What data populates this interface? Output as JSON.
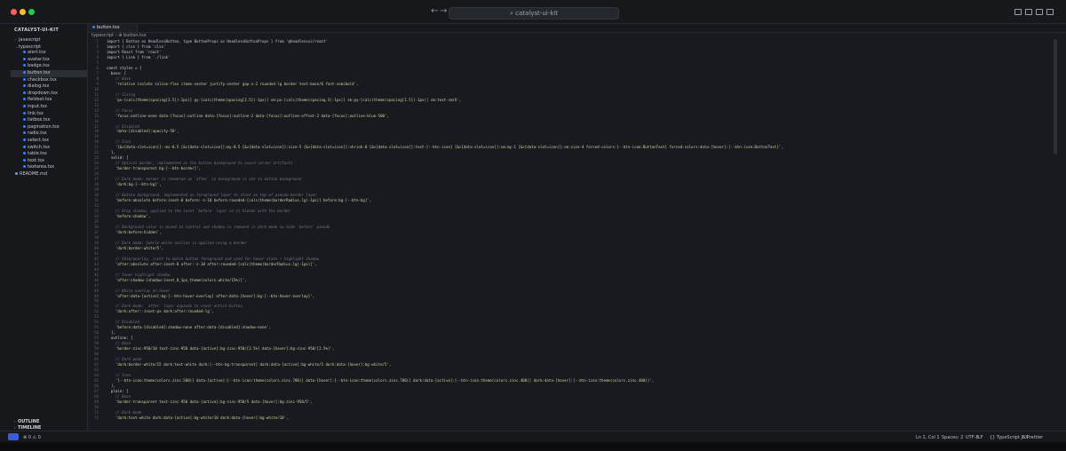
{
  "window": {
    "search_text": "⌕ catalyst-ui-kit",
    "nav_back": "←",
    "nav_forward": "→"
  },
  "sidebar": {
    "title": "CATALYST-UI-KIT",
    "tree": [
      {
        "label": "javascript",
        "type": "folder",
        "depth": 1,
        "chevron": "›"
      },
      {
        "label": "typescript",
        "type": "folder",
        "depth": 1,
        "chevron": "⌄"
      },
      {
        "label": "alert.tsx",
        "type": "file",
        "depth": 2
      },
      {
        "label": "avatar.tsx",
        "type": "file",
        "depth": 2
      },
      {
        "label": "badge.tsx",
        "type": "file",
        "depth": 2
      },
      {
        "label": "button.tsx",
        "type": "file",
        "depth": 2,
        "active": true
      },
      {
        "label": "checkbox.tsx",
        "type": "file",
        "depth": 2
      },
      {
        "label": "dialog.tsx",
        "type": "file",
        "depth": 2
      },
      {
        "label": "dropdown.tsx",
        "type": "file",
        "depth": 2
      },
      {
        "label": "fieldset.tsx",
        "type": "file",
        "depth": 2
      },
      {
        "label": "input.tsx",
        "type": "file",
        "depth": 2
      },
      {
        "label": "link.tsx",
        "type": "file",
        "depth": 2
      },
      {
        "label": "listbox.tsx",
        "type": "file",
        "depth": 2
      },
      {
        "label": "pagination.tsx",
        "type": "file",
        "depth": 2
      },
      {
        "label": "radio.tsx",
        "type": "file",
        "depth": 2
      },
      {
        "label": "select.tsx",
        "type": "file",
        "depth": 2
      },
      {
        "label": "switch.tsx",
        "type": "file",
        "depth": 2
      },
      {
        "label": "table.tsx",
        "type": "file",
        "depth": 2
      },
      {
        "label": "text.tsx",
        "type": "file",
        "depth": 2
      },
      {
        "label": "textarea.tsx",
        "type": "file",
        "depth": 2
      },
      {
        "label": "README.md",
        "type": "md",
        "depth": 1
      }
    ],
    "outline_label": "OUTLINE",
    "timeline_label": "TIMELINE"
  },
  "editor": {
    "tab_label": "button.tsx",
    "breadcrumb": "typescript › ⊕ button.tsx",
    "lines": [
      {
        "n": "1",
        "t": "import { Button as HeadlessButton, type ButtonProps as HeadlessButtonProps } from '@headlessui/react'",
        "k": "kw"
      },
      {
        "n": "2",
        "t": "import { clsx } from 'clsx'",
        "k": "kw"
      },
      {
        "n": "3",
        "t": "import React from 'react'",
        "k": "kw"
      },
      {
        "n": "4",
        "t": "import { Link } from './link'",
        "k": "kw"
      },
      {
        "n": "5",
        "t": "",
        "k": ""
      },
      {
        "n": "6",
        "t": "const styles = {",
        "k": ""
      },
      {
        "n": "7",
        "t": "  base: [",
        "k": ""
      },
      {
        "n": "8",
        "t": "    // Base",
        "k": "cm"
      },
      {
        "n": "9",
        "t": "    'relative isolate inline-flex items-center justify-center gap-x-2 rounded-lg border text-base/6 font-semibold',",
        "k": "str"
      },
      {
        "n": "10",
        "t": "",
        "k": ""
      },
      {
        "n": "11",
        "t": "    // Sizing",
        "k": "cm"
      },
      {
        "n": "12",
        "t": "    'px-[calc(theme(spacing[3.5])-1px)] py-[calc(theme(spacing[2.5])-1px)] sm:px-[calc(theme(spacing.3)-1px)] sm:py-[calc(theme(spacing[1.5])-1px)] sm:text-sm/6',",
        "k": "str"
      },
      {
        "n": "13",
        "t": "",
        "k": ""
      },
      {
        "n": "14",
        "t": "    // Focus",
        "k": "cm"
      },
      {
        "n": "15",
        "t": "    'focus:outline-none data-[focus]:outline data-[focus]:outline-2 data-[focus]:outline-offset-2 data-[focus]:outline-blue-500',",
        "k": "str"
      },
      {
        "n": "16",
        "t": "",
        "k": ""
      },
      {
        "n": "17",
        "t": "    // Disabled",
        "k": "cm"
      },
      {
        "n": "18",
        "t": "    'data-[disabled]:opacity-50',",
        "k": "str"
      },
      {
        "n": "19",
        "t": "",
        "k": ""
      },
      {
        "n": "20",
        "t": "    // Icon",
        "k": "cm"
      },
      {
        "n": "21",
        "t": "    '[&>[data-slot=icon]]:-mx-0.5 [&>[data-slot=icon]]:my-0.5 [&>[data-slot=icon]]:size-5 [&>[data-slot=icon]]:shrink-0 [&>[data-slot=icon]]:text-[--btn-icon] [&>[data-slot=icon]]:sm:my-1 [&>[data-slot=icon]]:sm:size-4 forced-colors:[--btn-icon:ButtonText] forced-colors:data-[hover]:[--btn-icon:ButtonText]',",
        "k": "str"
      },
      {
        "n": "22",
        "t": "  ],",
        "k": ""
      },
      {
        "n": "23",
        "t": "  solid: [",
        "k": ""
      },
      {
        "n": "24",
        "t": "    // Optical border, implemented as the button background to avoid corner artifacts",
        "k": "cm"
      },
      {
        "n": "25",
        "t": "    'border-transparent bg-[--btn-border]',",
        "k": "str"
      },
      {
        "n": "26",
        "t": "",
        "k": ""
      },
      {
        "n": "27",
        "t": "    // Dark mode: border is rendered on `after` so background is set to button background",
        "k": "cm"
      },
      {
        "n": "28",
        "t": "    'dark:bg-[--btn-bg]',",
        "k": "str"
      },
      {
        "n": "29",
        "t": "",
        "k": ""
      },
      {
        "n": "30",
        "t": "    // Button background, implemented as foreground layer to stack on top of pseudo-border layer",
        "k": "cm"
      },
      {
        "n": "31",
        "t": "    'before:absolute before:inset-0 before:-z-10 before:rounded-[calc(theme(borderRadius.lg)-1px)] before:bg-[--btn-bg]',",
        "k": "str"
      },
      {
        "n": "32",
        "t": "",
        "k": ""
      },
      {
        "n": "33",
        "t": "    // Drop shadow, applied to the inset `before` layer so it blends with the border",
        "k": "cm"
      },
      {
        "n": "34",
        "t": "    'before:shadow',",
        "k": "str"
      },
      {
        "n": "35",
        "t": "",
        "k": ""
      },
      {
        "n": "36",
        "t": "    // Background color is moved to control and shadow is removed in dark mode so hide `before` pseudo",
        "k": "cm"
      },
      {
        "n": "37",
        "t": "    'dark:before:hidden',",
        "k": "str"
      },
      {
        "n": "38",
        "t": "",
        "k": ""
      },
      {
        "n": "39",
        "t": "    // Dark mode: Subtle white outline is applied using a border",
        "k": "cm"
      },
      {
        "n": "40",
        "t": "    'dark:border-white/5',",
        "k": "str"
      },
      {
        "n": "41",
        "t": "",
        "k": ""
      },
      {
        "n": "42",
        "t": "    // Shim/overlay, inset to match button foreground and used for hover state + highlight shadow",
        "k": "cm"
      },
      {
        "n": "43",
        "t": "    'after:absolute after:inset-0 after:-z-10 after:rounded-[calc(theme(borderRadius.lg)-1px)]',",
        "k": "str"
      },
      {
        "n": "44",
        "t": "",
        "k": ""
      },
      {
        "n": "45",
        "t": "    // Inner highlight shadow",
        "k": "cm"
      },
      {
        "n": "46",
        "t": "    'after:shadow-[shadow:inset_0_1px_theme(colors.white/15%)]',",
        "k": "str"
      },
      {
        "n": "47",
        "t": "",
        "k": ""
      },
      {
        "n": "48",
        "t": "    // White overlay on hover",
        "k": "cm"
      },
      {
        "n": "49",
        "t": "    'after:data-[active]:bg-[--btn-hover-overlay] after:data-[hover]:bg-[--btn-hover-overlay]',",
        "k": "str"
      },
      {
        "n": "50",
        "t": "",
        "k": ""
      },
      {
        "n": "51",
        "t": "    // Dark mode: `after` layer expands to cover entire button",
        "k": "cm"
      },
      {
        "n": "52",
        "t": "    'dark:after:-inset-px dark:after:rounded-lg',",
        "k": "str"
      },
      {
        "n": "53",
        "t": "",
        "k": ""
      },
      {
        "n": "54",
        "t": "    // Disabled",
        "k": "cm"
      },
      {
        "n": "55",
        "t": "    'before:data-[disabled]:shadow-none after:data-[disabled]:shadow-none',",
        "k": "str"
      },
      {
        "n": "56",
        "t": "  ],",
        "k": ""
      },
      {
        "n": "57",
        "t": "  outline: [",
        "k": ""
      },
      {
        "n": "58",
        "t": "    // Base",
        "k": "cm"
      },
      {
        "n": "59",
        "t": "    'border-zinc-950/10 text-zinc-950 data-[active]:bg-zinc-950/[2.5%] data-[hover]:bg-zinc-950/[2.5%]',",
        "k": "str"
      },
      {
        "n": "60",
        "t": "",
        "k": ""
      },
      {
        "n": "61",
        "t": "    // Dark mode",
        "k": "cm"
      },
      {
        "n": "62",
        "t": "    'dark:border-white/15 dark:text-white dark:[--btn-bg:transparent] dark:data-[active]:bg-white/5 dark:data-[hover]:bg-white/5',",
        "k": "str"
      },
      {
        "n": "63",
        "t": "",
        "k": ""
      },
      {
        "n": "64",
        "t": "    // Icon",
        "k": "cm"
      },
      {
        "n": "65",
        "t": "    '[--btn-icon:theme(colors.zinc.500)] data-[active]:[--btn-icon:theme(colors.zinc.700)] data-[hover]:[--btn-icon:theme(colors.zinc.700)] dark:data-[active]:[--btn-icon:theme(colors.zinc.400)] dark:data-[hover]:[--btn-icon:theme(colors.zinc.400)]',",
        "k": "str"
      },
      {
        "n": "66",
        "t": "  ],",
        "k": ""
      },
      {
        "n": "67",
        "t": "  plain: [",
        "k": ""
      },
      {
        "n": "68",
        "t": "    // Base",
        "k": "cm"
      },
      {
        "n": "69",
        "t": "    'border-transparent text-zinc-950 data-[active]:bg-zinc-950/5 data-[hover]:bg-zinc-950/5',",
        "k": "str"
      },
      {
        "n": "70",
        "t": "",
        "k": ""
      },
      {
        "n": "71",
        "t": "    // Dark mode",
        "k": "cm"
      },
      {
        "n": "72",
        "t": "    'dark:text-white dark:data-[active]:bg-white/10 dark:data-[hover]:bg-white/10',",
        "k": "str"
      }
    ]
  },
  "statusbar": {
    "problems": "⊗ 0  ⚠ 0",
    "position": "Ln 1, Col 1",
    "spaces": "Spaces: 2",
    "encoding": "UTF-8",
    "eol": "LF",
    "language": "{} TypeScript JSX",
    "formatter": "✓ Prettier"
  }
}
